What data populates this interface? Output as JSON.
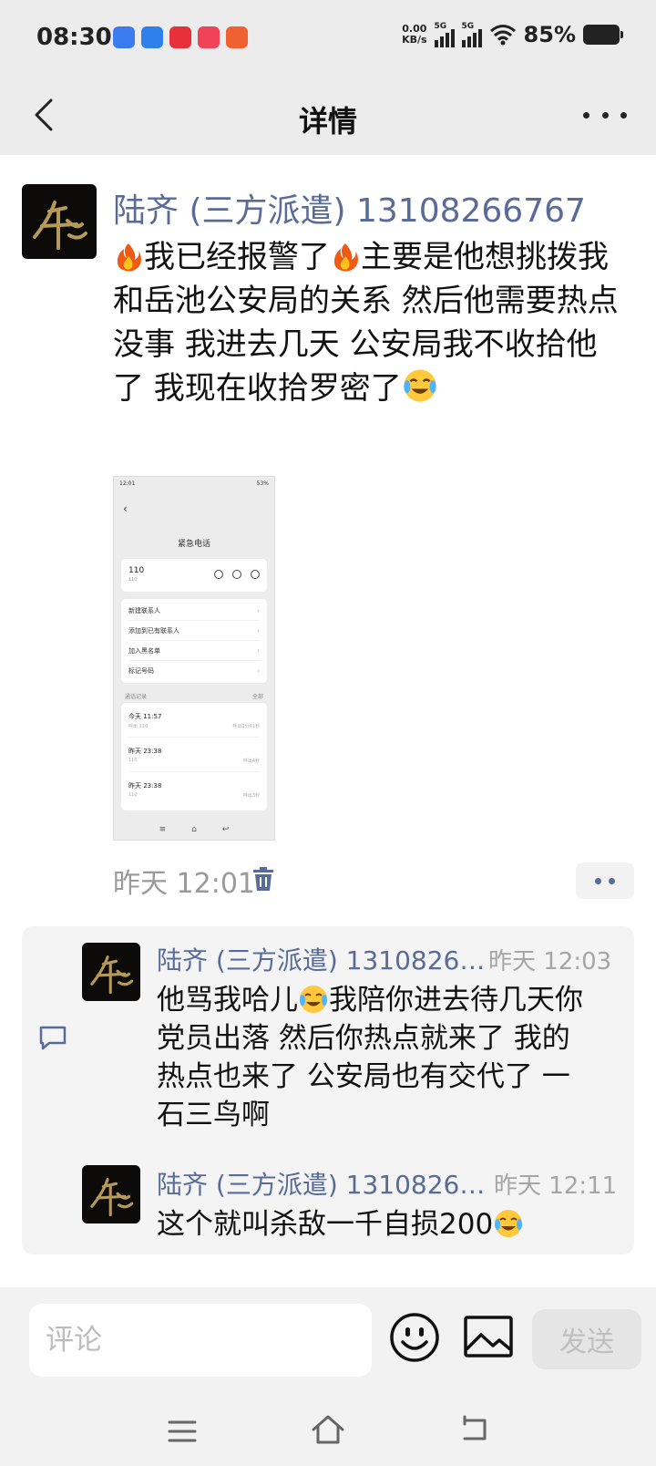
{
  "status_bar": {
    "time": "08:30",
    "net_speed_value": "0.00",
    "net_speed_unit": "KB/s",
    "signal_1": "5G",
    "signal_2": "5G",
    "battery": "85%"
  },
  "header": {
    "title": "详情",
    "back_icon": "chevron-left-icon",
    "more_icon": "more-dots-icon"
  },
  "post": {
    "author": "陆齐 (三方派遣) 13108266767",
    "text_parts": [
      "我已经报警了",
      "主要是他想挑拨我和岳池公安局的关系 然后他需要热点 没事 我进去几天 公安局我不收拾他了 我现在收拾罗密了"
    ],
    "time": "昨天 12:01",
    "screenshot": {
      "status_time": "12:01",
      "status_battery": "53%",
      "title": "紧急电话",
      "number": "110",
      "number_sub": "110",
      "actions": [
        "新建联系人",
        "添加到已有联系人",
        "加入黑名单",
        "标记号码"
      ],
      "records_label": "通话记录",
      "records_all": "全部",
      "calls": [
        {
          "time": "今天 11:57",
          "sub": "呼出 110",
          "duration": "呼出1分41秒"
        },
        {
          "time": "昨天 23:38",
          "sub": "110",
          "duration": "呼出4秒"
        },
        {
          "time": "昨天 23:38",
          "sub": "110",
          "duration": "呼出3秒"
        }
      ]
    }
  },
  "comments": [
    {
      "author": "陆齐 (三方派遣) 1310826…",
      "time": "昨天 12:03",
      "text_parts": [
        "他骂我哈儿",
        "我陪你进去待几天你党员出落 然后你热点就来了 我的热点也来了 公安局也有交代了 一石三鸟啊"
      ]
    },
    {
      "author": "陆齐 (三方派遣) 1310826…",
      "time": "昨天 12:11",
      "text_parts": [
        "这个就叫杀敌一千自损200"
      ]
    }
  ],
  "input": {
    "placeholder": "评论",
    "send_label": "发送"
  },
  "colors": {
    "link": "#586b99",
    "background": "#ececec"
  }
}
